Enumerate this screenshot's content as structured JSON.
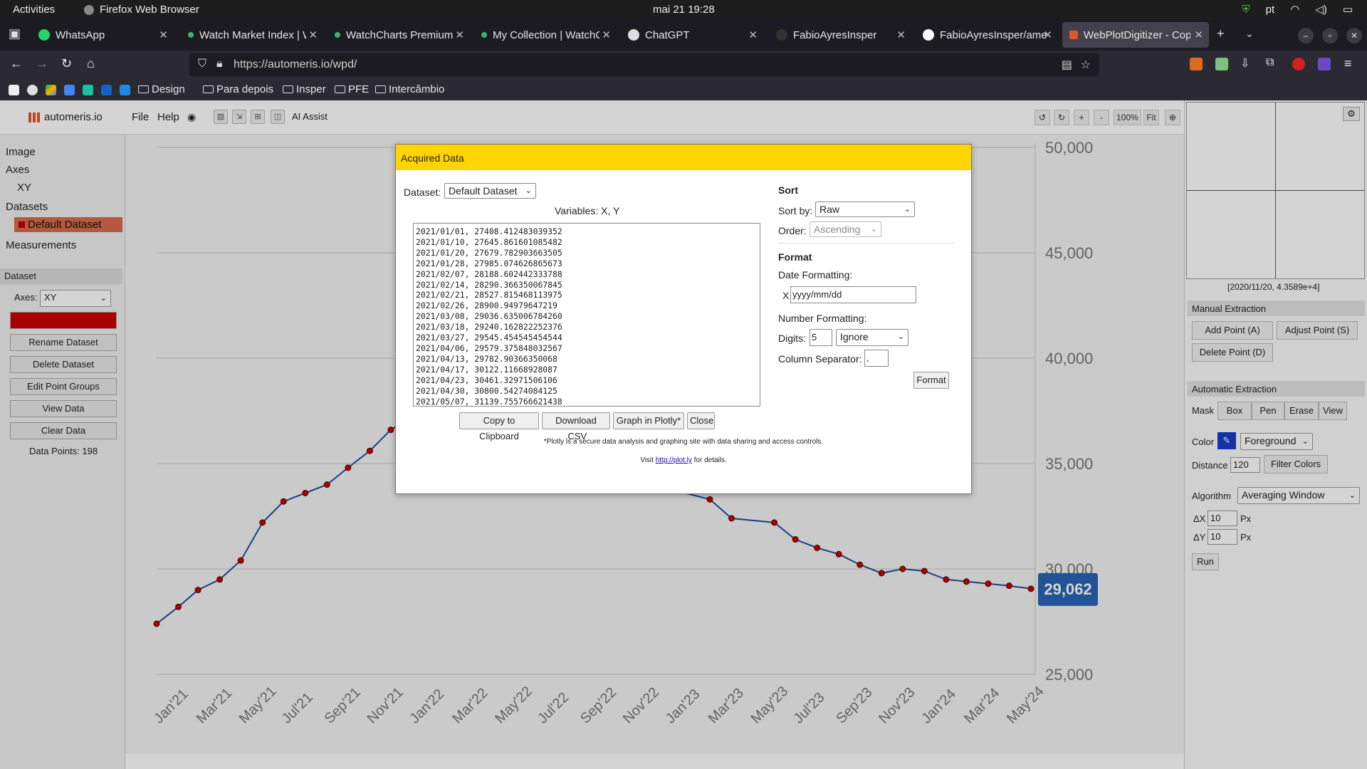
{
  "system": {
    "activities": "Activities",
    "app_name": "Firefox Web Browser",
    "clock": "mai 21  19:28",
    "lang": "pt"
  },
  "tabs": [
    {
      "label": "WhatsApp",
      "color": "#25d366"
    },
    {
      "label": "Watch Market Index | W",
      "color": "#3cb371"
    },
    {
      "label": "WatchCharts Premium",
      "color": "#3cb371"
    },
    {
      "label": "My Collection | WatchC",
      "color": "#3cb371"
    },
    {
      "label": "ChatGPT",
      "color": "#ffffff"
    },
    {
      "label": "FabioAyresInsper",
      "color": "#444444"
    },
    {
      "label": "FabioAyresInsper/ame",
      "color": "#ffffff"
    },
    {
      "label": "WebPlotDigitizer - Cop",
      "color": "#e0552a"
    }
  ],
  "url": "https://automeris.io/wpd/",
  "bookmarks": [
    "Design",
    "Para depois",
    "Insper",
    "PFE",
    "Intercâmbio"
  ],
  "app": {
    "brand": "automeris.io",
    "menu": [
      "File",
      "Help"
    ],
    "ai_assist": "AI Assist",
    "zoom": "100%",
    "fit": "Fit",
    "zoom_plus": "+",
    "zoom_minus": "-"
  },
  "sidebar": {
    "image": "Image",
    "axes": "Axes",
    "axes_xy": "XY",
    "datasets": "Datasets",
    "default_dataset": "Default Dataset",
    "measurements": "Measurements",
    "dataset_section": "Dataset",
    "axes_label": "Axes:",
    "axes_value": "XY",
    "buttons": [
      "Display Color",
      "Rename Dataset",
      "Delete Dataset",
      "Edit Point Groups",
      "View Data",
      "Clear Data"
    ],
    "data_points": "Data Points: 198"
  },
  "chart_data": {
    "type": "line",
    "title": "",
    "xlabel": "",
    "ylabel": "",
    "x_tick_labels": [
      "Jan'21",
      "Mar'21",
      "May'21",
      "Jul'21",
      "Sep'21",
      "Nov'21",
      "Jan'22",
      "Mar'22",
      "May'22",
      "Jul'22",
      "Sep'22",
      "Nov'22",
      "Jan'23",
      "Mar'23",
      "May'23",
      "Jul'23",
      "Sep'23",
      "Nov'23",
      "Jan'24",
      "Mar'24",
      "May'24"
    ],
    "y_tick_labels": [
      "50,000",
      "45,000",
      "40,000",
      "35,000",
      "30,000",
      "25,000"
    ],
    "ylim": [
      25000,
      50000
    ],
    "current_value_label": "29,062",
    "grid": true,
    "series": [
      {
        "color": "#cc0000",
        "x": [
          "2021/01/01",
          "2021/02/01",
          "2021/03/01",
          "2021/04/01",
          "2021/05/01",
          "2021/06/01",
          "2021/07/01",
          "2021/08/01",
          "2021/09/01",
          "2021/10/01",
          "2021/11/01",
          "2021/12/01",
          "2022/01/01",
          "2023/01/01",
          "2023/03/01",
          "2023/04/01",
          "2023/06/01",
          "2023/07/01",
          "2023/08/01",
          "2023/09/01",
          "2023/10/01",
          "2023/11/01",
          "2023/12/01",
          "2024/01/01",
          "2024/02/01",
          "2024/03/01",
          "2024/04/01",
          "2024/05/01",
          "2024/06/01"
        ],
        "y": [
          27400,
          28200,
          29000,
          29500,
          30400,
          32200,
          33200,
          33600,
          34000,
          34800,
          35600,
          36600,
          37200,
          33800,
          33300,
          32400,
          32200,
          31400,
          31000,
          30700,
          30200,
          29800,
          30000,
          29900,
          29500,
          29400,
          29300,
          29200,
          29060
        ]
      }
    ]
  },
  "dialog": {
    "title": "Acquired Data",
    "dataset_label": "Dataset:",
    "dataset_value": "Default Dataset",
    "variables": "Variables: X, Y",
    "rows": [
      "2021/01/01, 27408.412483039352",
      "2021/01/10, 27645.861601085482",
      "2021/01/20, 27679.782903663505",
      "2021/01/28, 27985.074626865673",
      "2021/02/07, 28188.602442333788",
      "2021/02/14, 28290.366350067845",
      "2021/02/21, 28527.815468113975",
      "2021/02/26, 28900.94979647219",
      "2021/03/08, 29036.635006784260",
      "2021/03/18, 29240.162822252376",
      "2021/03/27, 29545.454545454544",
      "2021/04/06, 29579.375848032567",
      "2021/04/13, 29782.90366350068",
      "2021/04/17, 30122.11668928087",
      "2021/04/23, 30461.32971506106",
      "2021/04/30, 30800.54274084125",
      "2021/05/07, 31139.755766621438"
    ],
    "buttons": [
      "Copy to Clipboard",
      "Download .CSV",
      "Graph in Plotly*",
      "Close"
    ],
    "note1": "*Plotly is a secure data analysis and graphing site with data sharing and access controls.",
    "note2_pre": "Visit ",
    "note2_link": "http://plot.ly",
    "note2_post": " for details.",
    "sort_title": "Sort",
    "sort_by_label": "Sort by:",
    "sort_by_value": "Raw",
    "order_label": "Order:",
    "order_value": "Ascending",
    "format_title": "Format",
    "date_formatting": "Date Formatting:",
    "x_label": "X",
    "date_format_value": "yyyy/mm/dd",
    "number_formatting": "Number Formatting:",
    "digits_label": "Digits:",
    "digits_value": "5",
    "digits_mode": "Ignore",
    "col_sep_label": "Column Separator:",
    "col_sep_value": ",",
    "format_button": "Format"
  },
  "right_panel": {
    "cursor_readout": "[2020/11/20, 4.3589e+4]",
    "manual_title": "Manual Extraction",
    "add_point": "Add Point (A)",
    "adjust_point": "Adjust Point (S)",
    "delete_point": "Delete Point (D)",
    "auto_title": "Automatic Extraction",
    "mask_label": "Mask",
    "mask_tabs": [
      "Box",
      "Pen",
      "Erase",
      "View"
    ],
    "color_label": "Color",
    "color_mode": "Foreground",
    "distance_label": "Distance",
    "distance_value": "120",
    "filter_colors": "Filter Colors",
    "algorithm_label": "Algorithm",
    "algorithm_value": "Averaging Window",
    "dx_label": "ΔX",
    "dx_value": "10",
    "dy_label": "ΔY",
    "dy_value": "10",
    "px": "Px",
    "run": "Run"
  }
}
